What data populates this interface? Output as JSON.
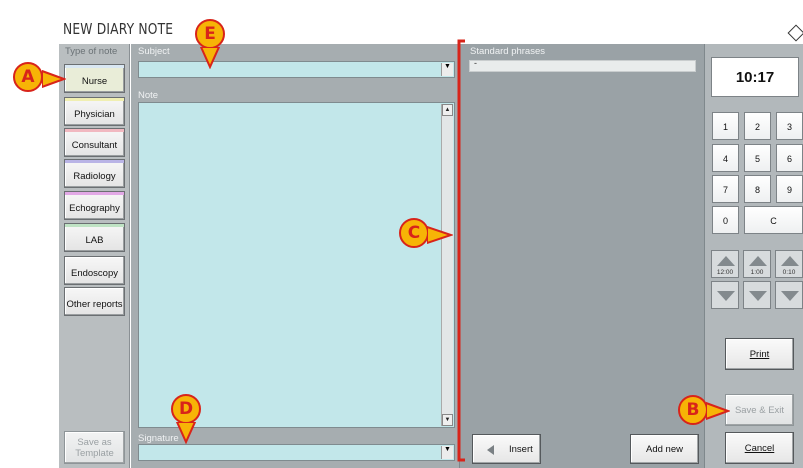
{
  "window": {
    "title": "NEW DIARY NOTE"
  },
  "left": {
    "type_label": "Type of note",
    "note_types": [
      {
        "label": "Nurse",
        "color": "#d9e7f2"
      },
      {
        "label": "Physician",
        "color": "#f0efb2"
      },
      {
        "label": "Consultant",
        "color": "#f1b8c0"
      },
      {
        "label": "Radiology",
        "color": "#b9b4e6"
      },
      {
        "label": "Echography",
        "color": "#e2a8e6"
      },
      {
        "label": "LAB",
        "color": "#bfe3c4"
      },
      {
        "label": "Endoscopy",
        "color": ""
      },
      {
        "label": "Other reports",
        "color": ""
      }
    ],
    "save_template_label": "Save as Template"
  },
  "main": {
    "subject_label": "Subject",
    "subject_value": "",
    "note_label": "Note",
    "note_value": "",
    "signature_label": "Signature",
    "signature_value": ""
  },
  "phrases": {
    "label": "Standard phrases",
    "items": [
      "-"
    ],
    "insert_label": "Insert",
    "add_new_label": "Add new"
  },
  "right": {
    "time": "10:17",
    "keys": [
      "1",
      "2",
      "3",
      "4",
      "5",
      "6",
      "7",
      "8",
      "9",
      "0",
      "C"
    ],
    "arrow_labels": [
      "12:00",
      "1:00",
      "0:10"
    ],
    "print_label": "Print",
    "save_exit_label": "Save & Exit",
    "cancel_label": "Cancel"
  },
  "markers": [
    "A",
    "B",
    "C",
    "D",
    "E"
  ],
  "colors": {
    "accent": "#d8241a",
    "marker_fill": "#f7b406",
    "field": "#c2e7ea"
  }
}
